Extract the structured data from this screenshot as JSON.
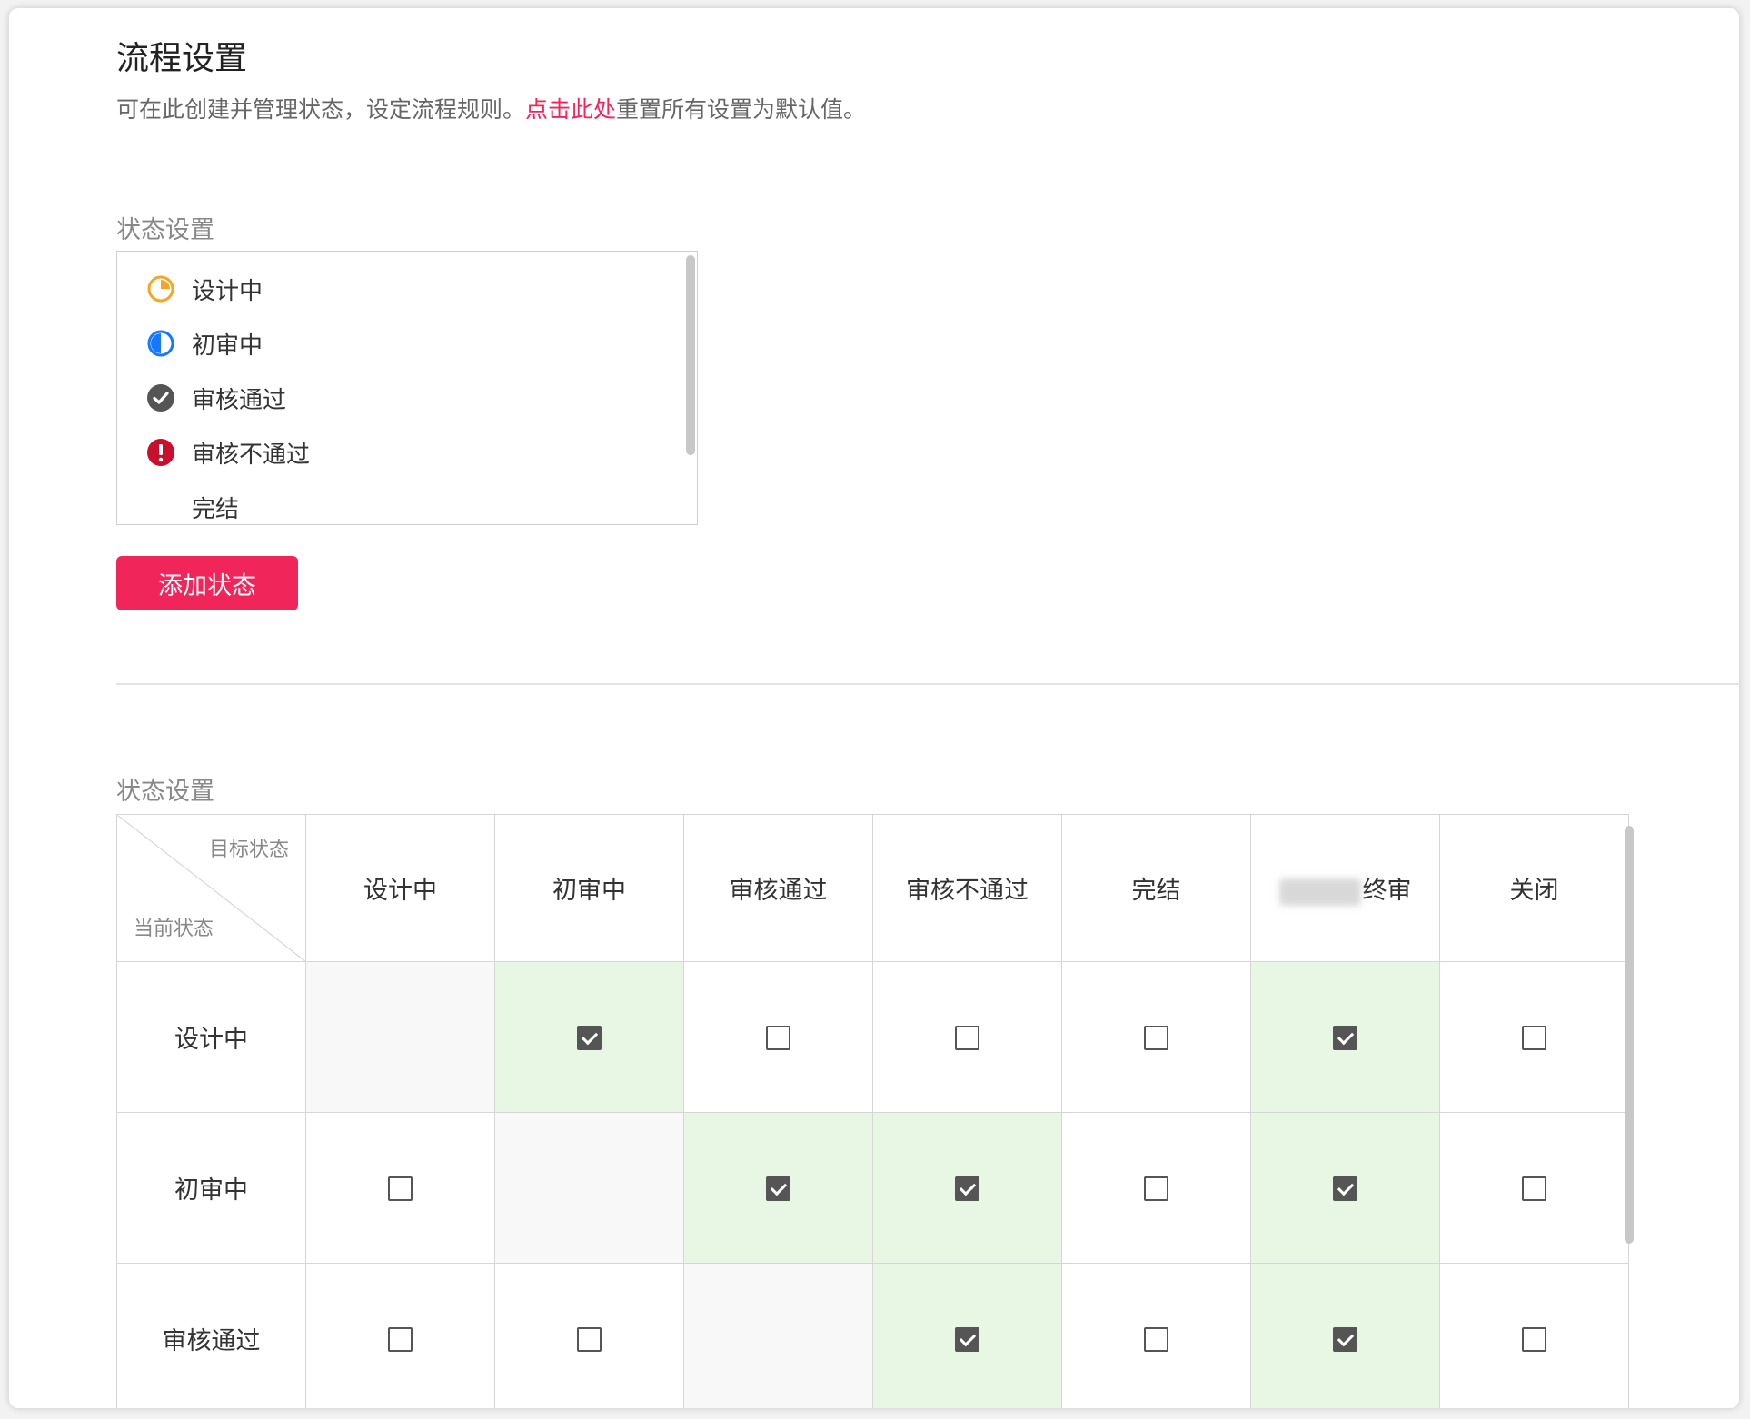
{
  "page": {
    "title": "流程设置",
    "desc_prefix": "可在此创建并管理状态，设定流程规则。",
    "desc_link": "点击此处",
    "desc_suffix": "重置所有设置为默认值。"
  },
  "status_section": {
    "label": "状态设置",
    "items": [
      {
        "label": "设计中",
        "icon": "pie-icon-orange",
        "color": "#f5a623"
      },
      {
        "label": "初审中",
        "icon": "half-circle-icon-blue",
        "color": "#1677ff"
      },
      {
        "label": "审核通过",
        "icon": "check-circle-icon",
        "color": "#555555"
      },
      {
        "label": "审核不通过",
        "icon": "exclamation-circle-icon",
        "color": "#c8102e"
      },
      {
        "label": "完结",
        "icon": "",
        "color": ""
      }
    ],
    "add_button": "添加状态"
  },
  "matrix_section": {
    "label": "状态设置",
    "corner_target": "目标状态",
    "corner_current": "当前状态",
    "columns": [
      "设计中",
      "初审中",
      "审核通过",
      "审核不通过",
      "完结",
      "终审",
      "关闭"
    ],
    "rows": [
      {
        "label": "设计中",
        "cells": [
          "diag",
          "on",
          "off",
          "off",
          "off",
          "on",
          "off"
        ]
      },
      {
        "label": "初审中",
        "cells": [
          "off",
          "diag",
          "on",
          "on",
          "off",
          "on",
          "off"
        ]
      },
      {
        "label": "审核通过",
        "cells": [
          "off",
          "off",
          "diag",
          "on",
          "off",
          "on",
          "off"
        ]
      }
    ]
  },
  "colors": {
    "accent": "#f0265b",
    "checked_cell_bg": "#e8f7e4",
    "diagonal_cell_bg": "#f8f8f8"
  }
}
